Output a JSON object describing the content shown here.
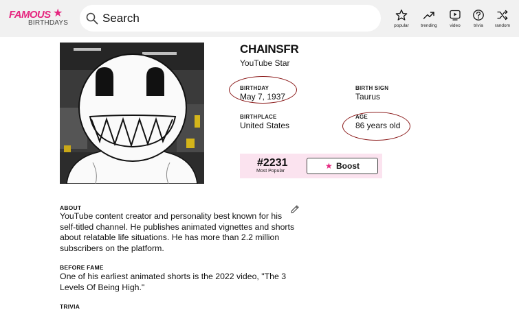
{
  "header": {
    "logo_top": "FAMOUS",
    "logo_bottom": "BIRTHDAYS",
    "search_placeholder": "Search",
    "nav": [
      {
        "label": "popular",
        "icon": "star-icon"
      },
      {
        "label": "trending",
        "icon": "trending-icon"
      },
      {
        "label": "video",
        "icon": "video-icon"
      },
      {
        "label": "trivia",
        "icon": "question-icon"
      },
      {
        "label": "random",
        "icon": "shuffle-icon"
      }
    ]
  },
  "profile": {
    "name": "CHAINSFR",
    "profession": "YouTube Star",
    "birthday_label": "BIRTHDAY",
    "birthday": "May 7, 1937",
    "birth_sign_label": "BIRTH SIGN",
    "birth_sign": "Taurus",
    "birthplace_label": "BIRTHPLACE",
    "birthplace": "United States",
    "age_label": "AGE",
    "age": "86 years old"
  },
  "rank": {
    "number": "#2231",
    "label": "Most Popular",
    "boost_label": "Boost"
  },
  "about": {
    "title": "ABOUT",
    "text": "YouTube content creator and personality best known for his self-titled channel. He publishes animated vignettes and shorts about relatable life situations. He has more than 2.2 million subscribers on the platform."
  },
  "before_fame": {
    "title": "BEFORE FAME",
    "text": "One of his earliest animated shorts is the 2022 video, \"The 3 Levels Of Being High.\""
  },
  "trivia": {
    "title": "TRIVIA"
  },
  "colors": {
    "brand_pink": "#e5267f",
    "rank_bg": "#fbe3ef",
    "annotation_circle": "#8b1a1a"
  }
}
